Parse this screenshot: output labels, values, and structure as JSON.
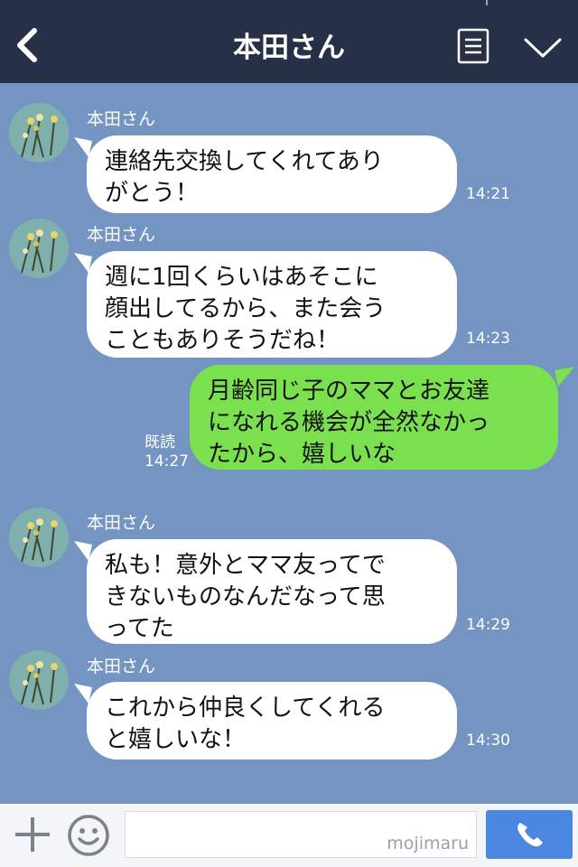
{
  "header": {
    "title": "本田さん",
    "back_icon": "chevron-left-icon",
    "menu_icon": "menu-list-icon",
    "collapse_icon": "chevron-down-icon"
  },
  "messages": [
    {
      "sender": "本田さん",
      "text": [
        "連絡先交換してくれてあり",
        "がとう！"
      ],
      "time": "14:21"
    },
    {
      "sender": "本田さん",
      "text": [
        "週に1回くらいはあそこに",
        "顔出してるから、また会う",
        "こともありそうだね！"
      ],
      "time": "14:23"
    },
    {
      "sender": "me",
      "text": [
        "月齢同じ子のママとお友達",
        "になれる機会が全然なかっ",
        "たから、嬉しいな"
      ],
      "read_label": "既読",
      "time": "14:27"
    },
    {
      "sender": "本田さん",
      "text": [
        "私も！意外とママ友ってで",
        "きないものなんだなって思",
        "ってた"
      ],
      "time": "14:29"
    },
    {
      "sender": "本田さん",
      "text": [
        "これから仲良くしてくれる",
        "と嬉しいな！"
      ],
      "time": "14:30"
    }
  ],
  "footer": {
    "plus_icon": "plus-icon",
    "emoji_icon": "smiley-icon",
    "input_value": "",
    "watermark": "mojimaru",
    "call_icon": "phone-icon"
  },
  "colors": {
    "header_bg": "#263148",
    "chat_bg": "#7495c2",
    "my_bubble": "#7be04e",
    "their_bubble": "#ffffff",
    "call_button": "#4a88e0"
  }
}
